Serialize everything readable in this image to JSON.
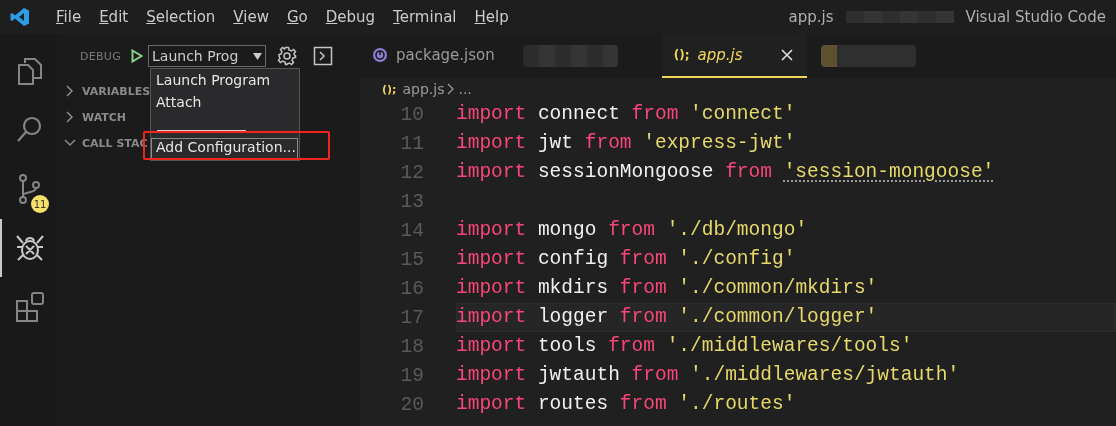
{
  "title_bar": {
    "menu": [
      "File",
      "Edit",
      "Selection",
      "View",
      "Go",
      "Debug",
      "Terminal",
      "Help"
    ],
    "title": "app.js",
    "app_name": "Visual Studio Code"
  },
  "activity_bar": [
    {
      "kind": "files",
      "selected": false
    },
    {
      "kind": "search",
      "selected": false
    },
    {
      "kind": "git",
      "selected": false,
      "badge": "11"
    },
    {
      "kind": "debug",
      "selected": true
    },
    {
      "kind": "extensions",
      "selected": false
    }
  ],
  "sidebar": {
    "title": "DEBUG",
    "configuration": "Launch Prog",
    "dropdown": [
      {
        "kind": "option",
        "label": "Launch Program",
        "selected": false
      },
      {
        "kind": "option",
        "label": "Attach",
        "selected": false
      },
      {
        "kind": "separator"
      },
      {
        "kind": "option",
        "label": "Add Configuration...",
        "selected": true
      }
    ],
    "sections": [
      {
        "label": "VARIABLES",
        "expanded": false
      },
      {
        "label": "WATCH",
        "expanded": false
      },
      {
        "label": "CALL STAC",
        "expanded": true
      }
    ]
  },
  "tabs": [
    {
      "kind": "json",
      "label": "package.json",
      "selected": false
    },
    {
      "kind": "redacted"
    },
    {
      "kind": "js",
      "icon": "();",
      "label": "app.js",
      "selected": true
    },
    {
      "kind": "redacted"
    }
  ],
  "breadcrumb": {
    "icon": "();",
    "file": "app.js",
    "rest": "..."
  },
  "code": [
    {
      "number": "10",
      "current": false,
      "tokens": [
        {
          "kind": "keyword",
          "text": "import"
        },
        {
          "kind": "name",
          "text": "connect"
        },
        {
          "kind": "keyword",
          "text": "from"
        },
        {
          "kind": "string",
          "text": "'connect'"
        }
      ]
    },
    {
      "number": "11",
      "current": false,
      "tokens": [
        {
          "kind": "keyword",
          "text": "import"
        },
        {
          "kind": "name",
          "text": "jwt"
        },
        {
          "kind": "keyword",
          "text": "from"
        },
        {
          "kind": "string",
          "text": "'express-jwt'"
        }
      ]
    },
    {
      "number": "12",
      "current": false,
      "tokens": [
        {
          "kind": "keyword",
          "text": "import"
        },
        {
          "kind": "name",
          "text": "sessionMongoose"
        },
        {
          "kind": "keyword",
          "text": "from"
        },
        {
          "kind": "string",
          "text": "'session-mongoose'",
          "hint": true
        }
      ]
    },
    {
      "number": "13",
      "current": false
    },
    {
      "number": "14",
      "current": false,
      "tokens": [
        {
          "kind": "keyword",
          "text": "import"
        },
        {
          "kind": "name",
          "text": "mongo"
        },
        {
          "kind": "keyword",
          "text": "from"
        },
        {
          "kind": "string",
          "text": "'./db/mongo'"
        }
      ]
    },
    {
      "number": "15",
      "current": false,
      "tokens": [
        {
          "kind": "keyword",
          "text": "import"
        },
        {
          "kind": "name",
          "text": "config"
        },
        {
          "kind": "keyword",
          "text": "from"
        },
        {
          "kind": "string",
          "text": "'./config'"
        }
      ]
    },
    {
      "number": "16",
      "current": false,
      "tokens": [
        {
          "kind": "keyword",
          "text": "import"
        },
        {
          "kind": "name",
          "text": "mkdirs"
        },
        {
          "kind": "keyword",
          "text": "from"
        },
        {
          "kind": "string",
          "text": "'./common/mkdirs'"
        }
      ]
    },
    {
      "number": "17",
      "current": true,
      "tokens": [
        {
          "kind": "keyword",
          "text": "import"
        },
        {
          "kind": "name",
          "text": "logger"
        },
        {
          "kind": "keyword",
          "text": "from"
        },
        {
          "kind": "string",
          "text": "'./common/logger'"
        }
      ]
    },
    {
      "number": "18",
      "current": false,
      "tokens": [
        {
          "kind": "keyword",
          "text": "import"
        },
        {
          "kind": "name",
          "text": "tools"
        },
        {
          "kind": "keyword",
          "text": "from"
        },
        {
          "kind": "string",
          "text": "'./middlewares/tools'"
        }
      ]
    },
    {
      "number": "19",
      "current": false,
      "tokens": [
        {
          "kind": "keyword",
          "text": "import"
        },
        {
          "kind": "name",
          "text": "jwtauth"
        },
        {
          "kind": "keyword",
          "text": "from"
        },
        {
          "kind": "string",
          "text": "'./middlewares/jwtauth'"
        }
      ]
    },
    {
      "number": "20",
      "current": false,
      "tokens": [
        {
          "kind": "keyword",
          "text": "import"
        },
        {
          "kind": "name",
          "text": "routes"
        },
        {
          "kind": "keyword",
          "text": "from"
        },
        {
          "kind": "string",
          "text": "'./routes'"
        }
      ]
    }
  ]
}
